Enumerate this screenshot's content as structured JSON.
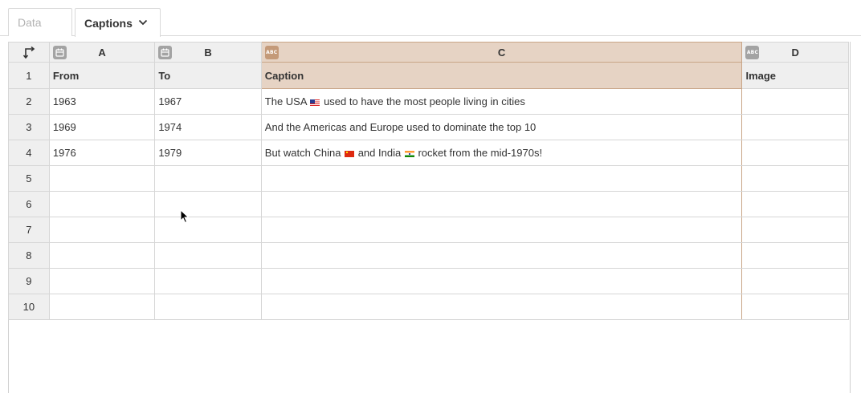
{
  "tabs": [
    {
      "label": "Data",
      "active": false
    },
    {
      "label": "Captions",
      "active": true
    }
  ],
  "grid": {
    "columns": [
      {
        "letter": "A",
        "type_icon": "calendar-icon",
        "selected": false
      },
      {
        "letter": "B",
        "type_icon": "calendar-icon",
        "selected": false
      },
      {
        "letter": "C",
        "type_icon": "text-type-icon",
        "type_text": "ABC",
        "selected": true
      },
      {
        "letter": "D",
        "type_icon": "text-type-icon",
        "type_text": "ABC",
        "selected": false
      }
    ],
    "row_numbers": [
      "1",
      "2",
      "3",
      "4",
      "5",
      "6",
      "7",
      "8",
      "9",
      "10"
    ],
    "header_row": [
      "From",
      "To",
      "Caption",
      "Image"
    ],
    "rows": [
      {
        "from": "1963",
        "to": "1967",
        "caption_parts": [
          "The USA",
          "used to have the most people living in cities"
        ],
        "caption_flags": [
          "us-flag"
        ],
        "image": ""
      },
      {
        "from": "1969",
        "to": "1974",
        "caption_parts": [
          "And the Americas and Europe used to dominate the top 10"
        ],
        "caption_flags": [],
        "image": ""
      },
      {
        "from": "1976",
        "to": "1979",
        "caption_parts": [
          "But watch China",
          "and India",
          "rocket from the mid-1970s!"
        ],
        "caption_flags": [
          "china-flag",
          "india-flag"
        ],
        "image": ""
      }
    ]
  },
  "colors": {
    "selected_column": "#e6d3c4",
    "selected_border": "#c8a587",
    "header_bg": "#efefef"
  }
}
